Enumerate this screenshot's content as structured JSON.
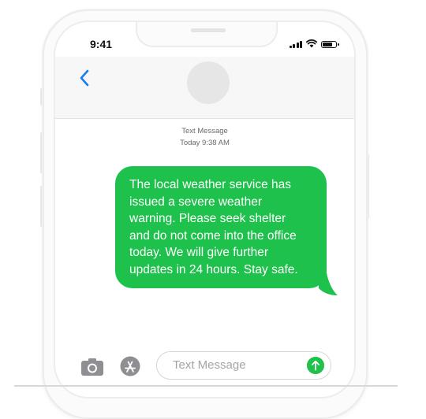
{
  "status_bar": {
    "time": "9:41",
    "battery_level": 0.85,
    "icons": [
      "signal-icon",
      "wifi-icon",
      "battery-icon"
    ]
  },
  "header": {
    "back_icon": "chevron-left-icon",
    "contact_avatar": "contact-avatar"
  },
  "thread": {
    "service_label": "Text Message",
    "timestamp": "Today 9:38 AM"
  },
  "message": {
    "direction": "outgoing",
    "lines": [
      "The local weather service has",
      "issued a severe weather",
      "warning. Please seek shelter",
      "and do not come into the office",
      "today. We will give further",
      "updates in 24 hours. Stay safe."
    ]
  },
  "composer": {
    "placeholder": "Text Message",
    "camera_icon": "camera-icon",
    "apps_icon": "app-store-icon",
    "send_icon": "send-arrow-icon"
  },
  "colors": {
    "bubble": "#1ec14b",
    "accent": "#1a7cf2",
    "frame": "#fbfbfb"
  }
}
